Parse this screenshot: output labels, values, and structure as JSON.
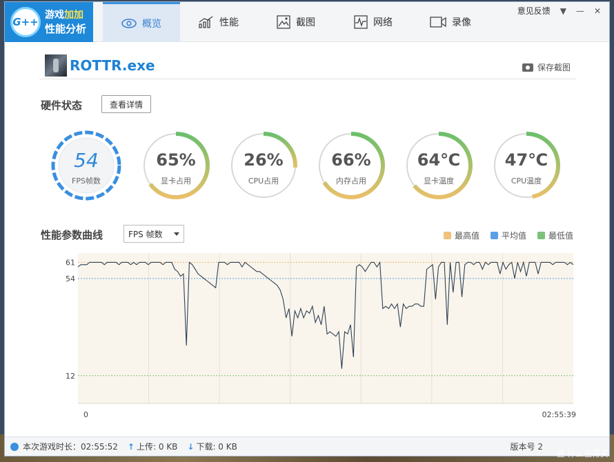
{
  "app": {
    "logo_line1_a": "游戏",
    "logo_line1_b": "加加",
    "logo_line2": "性能分析",
    "logo_badge": "G++"
  },
  "tabs": [
    {
      "label": "概览",
      "icon": "eye-icon",
      "active": true
    },
    {
      "label": "性能",
      "icon": "bar-chart-icon",
      "active": false
    },
    {
      "label": "截图",
      "icon": "image-icon",
      "active": false
    },
    {
      "label": "网络",
      "icon": "pulse-icon",
      "active": false
    },
    {
      "label": "录像",
      "icon": "video-icon",
      "active": false
    }
  ],
  "topbar": {
    "feedback": "意见反馈"
  },
  "game": {
    "name": "ROTTR.exe",
    "save_screenshot": "保存截图"
  },
  "hardware": {
    "title": "硬件状态",
    "detail_button": "查看详情"
  },
  "gauges": [
    {
      "value": "54",
      "label": "FPS帧数",
      "fraction": 1.0,
      "kind": "fps"
    },
    {
      "value": "65%",
      "label": "显卡占用",
      "fraction": 0.65
    },
    {
      "value": "26%",
      "label": "CPU占用",
      "fraction": 0.26
    },
    {
      "value": "66%",
      "label": "内存占用",
      "fraction": 0.66
    },
    {
      "value": "64℃",
      "label": "显卡温度",
      "fraction": 0.64
    },
    {
      "value": "47℃",
      "label": "CPU温度",
      "fraction": 0.47
    }
  ],
  "curve": {
    "title": "性能参数曲线",
    "select_value": "FPS 帧数",
    "legend": [
      {
        "label": "最高值",
        "color": "#f0c27a"
      },
      {
        "label": "平均值",
        "color": "#5b9ee6"
      },
      {
        "label": "最低值",
        "color": "#7cc07c"
      }
    ]
  },
  "chart_data": {
    "type": "line",
    "y_max_label": "61",
    "y_avg_label": "54",
    "y_min_label": "12",
    "max": 61,
    "avg": 54,
    "min": 12,
    "ylim": [
      0,
      65
    ],
    "x_start_label": "0",
    "x_end_label": "02:55:39",
    "values": [
      59,
      60,
      60,
      60,
      61,
      61,
      61,
      61,
      61,
      60,
      61,
      61,
      61,
      61,
      60,
      61,
      61,
      61,
      60,
      61,
      60,
      61,
      61,
      61,
      60,
      61,
      61,
      61,
      61,
      60,
      61,
      61,
      61,
      58,
      57,
      55,
      56,
      25,
      61,
      60,
      58,
      56,
      55,
      54,
      53,
      52,
      51,
      50,
      61,
      61,
      61,
      60,
      61,
      61,
      61,
      61,
      59,
      61,
      60,
      59,
      58,
      57,
      57,
      56,
      55,
      54,
      53,
      52,
      51,
      49,
      45,
      37,
      41,
      29,
      40,
      37,
      41,
      37,
      40,
      39,
      42,
      35,
      38,
      34,
      42,
      30,
      31,
      30,
      29,
      31,
      15,
      31,
      30,
      34,
      20,
      59,
      60,
      59,
      57,
      59,
      61,
      61,
      59,
      61,
      41,
      42,
      41,
      43,
      41,
      43,
      33,
      43,
      41,
      42,
      42,
      43,
      43,
      42,
      42,
      58,
      59,
      60,
      45,
      59,
      61,
      61,
      34,
      61,
      48,
      61,
      61,
      46,
      60,
      61,
      61,
      60,
      61,
      61,
      58,
      61,
      60,
      61,
      61,
      61,
      56,
      61,
      58,
      60,
      61,
      54,
      61,
      57,
      61,
      55,
      61,
      61,
      61,
      56,
      61,
      61,
      61,
      61,
      60,
      61,
      61,
      61,
      61,
      60,
      61,
      60
    ]
  },
  "status": {
    "duration_label": "本次游戏时长：02:55:52",
    "upload_label": "上传: 0 KB",
    "download_label": "下载: 0 KB",
    "version": "版本号 2",
    "watermark": "值 什么值得买"
  }
}
